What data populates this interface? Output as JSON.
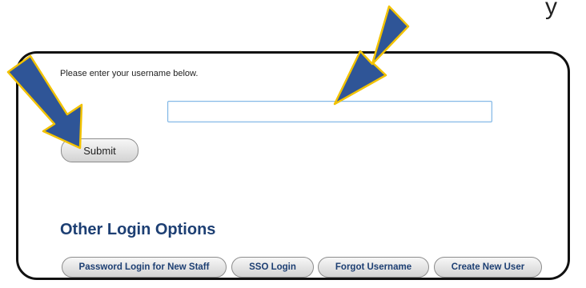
{
  "corner_glyph": "y",
  "form": {
    "prompt": "Please enter your username below.",
    "username_value": "",
    "submit_label": "Submit"
  },
  "other_options": {
    "heading": "Other Login Options",
    "buttons": [
      "Password Login for New Staff",
      "SSO Login",
      "Forgot Username",
      "Create New User"
    ]
  },
  "colors": {
    "arrow_fill": "#2f5597",
    "arrow_outline": "#f2c200",
    "heading": "#1d3f73",
    "input_border": "#7fb6e6"
  }
}
